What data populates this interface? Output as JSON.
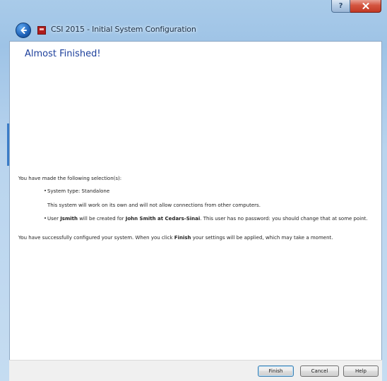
{
  "window": {
    "title": "CSI 2015 - Initial System Configuration",
    "help_glyph": "?",
    "accent_color": "#1c3f9b"
  },
  "heading": "Almost Finished!",
  "summary": {
    "intro": "You have made the following selection(s):",
    "system_type_label": "System type: Standalone",
    "system_type_desc": "This system will work on its own and will not allow connections from other computers.",
    "user_prefix": "User ",
    "user_name": "Jsmith",
    "user_middle": " will be created for ",
    "user_fullname": "John Smith at Cedars-Sinai",
    "user_suffix": ". This user has no password: you should change that at some point.",
    "final_prefix": "You have successfully configured your system. When you click ",
    "final_bold": "Finish",
    "final_suffix": " your settings will be applied, which may take a moment."
  },
  "buttons": {
    "finish": "Finish",
    "cancel": "Cancel",
    "help": "Help"
  }
}
